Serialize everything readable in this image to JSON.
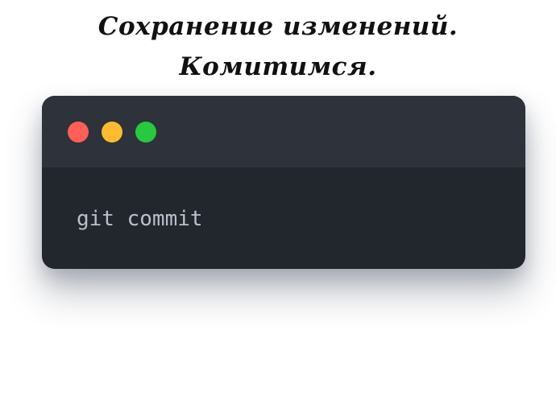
{
  "heading": {
    "line1": "Сохранение изменений.",
    "line2": "Комитимся."
  },
  "terminal": {
    "window_buttons": {
      "close_color": "#ff5f57",
      "minimize_color": "#febc2e",
      "maximize_color": "#28c840"
    },
    "command": "git commit"
  }
}
